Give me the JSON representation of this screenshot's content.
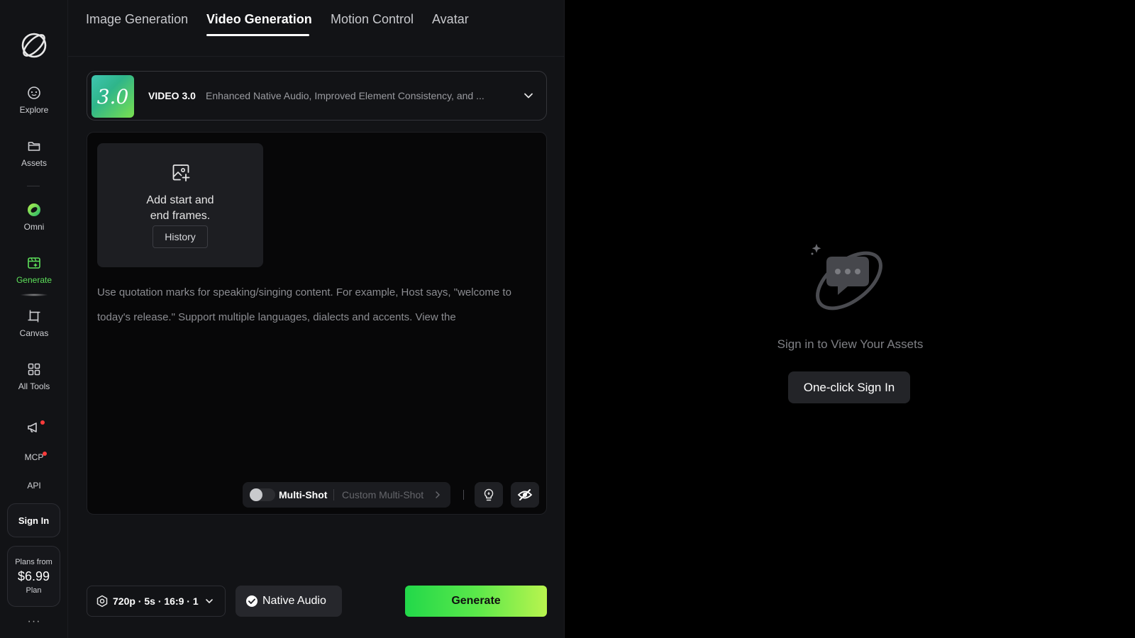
{
  "rail": {
    "explore": "Explore",
    "assets": "Assets",
    "omni": "Omni",
    "generate": "Generate",
    "canvas": "Canvas",
    "all_tools": "All Tools",
    "mcp": "MCP",
    "api": "API",
    "sign_in": "Sign In",
    "plans_from": "Plans from",
    "plan_price": "$6.99",
    "plan": "Plan",
    "more": "···",
    "accent_color": "#5de05a"
  },
  "tabs": [
    {
      "label": "Image Generation",
      "active": false
    },
    {
      "label": "Video Generation",
      "active": true
    },
    {
      "label": "Motion Control",
      "active": false
    },
    {
      "label": "Avatar",
      "active": false
    }
  ],
  "model": {
    "badge": "3.0",
    "name": "VIDEO 3.0",
    "description": "Enhanced Native Audio, Improved Element Consistency, and ..."
  },
  "frames": {
    "line1": "Add start and",
    "line2": "end frames.",
    "history": "History"
  },
  "prompt": {
    "text": "Use quotation marks for speaking/singing content. For example, Host says, \"welcome to today's release.\" Support multiple languages, dialects and accents. View the"
  },
  "toolbar": {
    "multishot": "Multi-Shot",
    "custom_multishot": "Custom Multi-Shot"
  },
  "bottom": {
    "settings": "720p · 5s · 16:9 · 1",
    "native_audio": "Native Audio",
    "generate": "Generate"
  },
  "assets": {
    "empty_text": "Sign in to View Your Assets",
    "sign_in_button": "One-click Sign In"
  }
}
